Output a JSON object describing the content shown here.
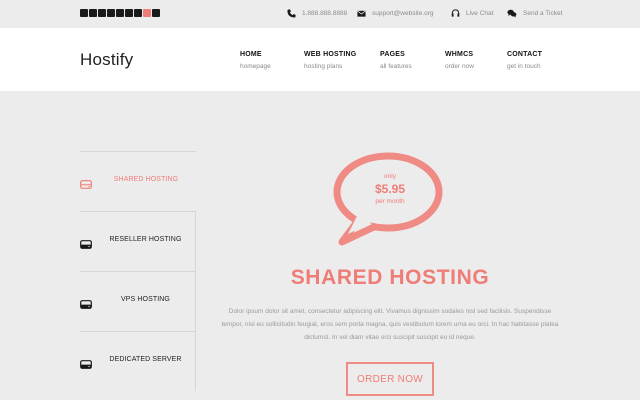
{
  "topbar": {
    "social_icons": [
      "facebook-icon",
      "twitter-icon",
      "vimeo-icon",
      "youtube-icon",
      "flickr-icon",
      "google-plus-icon",
      "instagram-icon",
      "rss-icon",
      "skype-icon"
    ],
    "phone": "1.888.888.8888",
    "email": "support@website.org",
    "live_chat": "Live Chat",
    "send_ticket": "Send a Ticket"
  },
  "header": {
    "logo": "Hostify",
    "nav": [
      {
        "title": "HOME",
        "subtitle": "homepage"
      },
      {
        "title": "WEB HOSTING",
        "subtitle": "hosting plans"
      },
      {
        "title": "PAGES",
        "subtitle": "all features"
      },
      {
        "title": "WHMCS",
        "subtitle": "order now"
      },
      {
        "title": "CONTACT",
        "subtitle": "get in touch"
      }
    ]
  },
  "sidebar": {
    "items": [
      {
        "label": "SHARED HOSTING",
        "icon": "hard-drive-icon",
        "active": true
      },
      {
        "label": "RESELLER HOSTING",
        "icon": "hard-drive-icon",
        "active": false
      },
      {
        "label": "VPS HOSTING",
        "icon": "hard-drive-icon",
        "active": false
      },
      {
        "label": "DEDICATED SERVER",
        "icon": "hard-drive-icon",
        "active": false
      }
    ]
  },
  "main": {
    "bubble": {
      "only": "only",
      "price": "$5.95",
      "per": "per month"
    },
    "heading": "SHARED HOSTING",
    "description": "Dolor ipsum dolor sit amet, consectetur adipiscing elit. Vivamus dignissim sodales nisl sed facilisis. Suspendisse tempor, nisl eu sollicitudin feugiat, eros sem porta magna, quis vestibulum lorem urna eu orci. In hac habitasse platea dictumst. In vel diam vitae orci suscipit suscipit eu id neque.",
    "order_button": "ORDER NOW"
  },
  "colors": {
    "accent": "#ef7d77",
    "background": "#ececec",
    "header_bg": "#ffffff",
    "text_dark": "#222222",
    "text_muted": "#9a9a9a"
  }
}
